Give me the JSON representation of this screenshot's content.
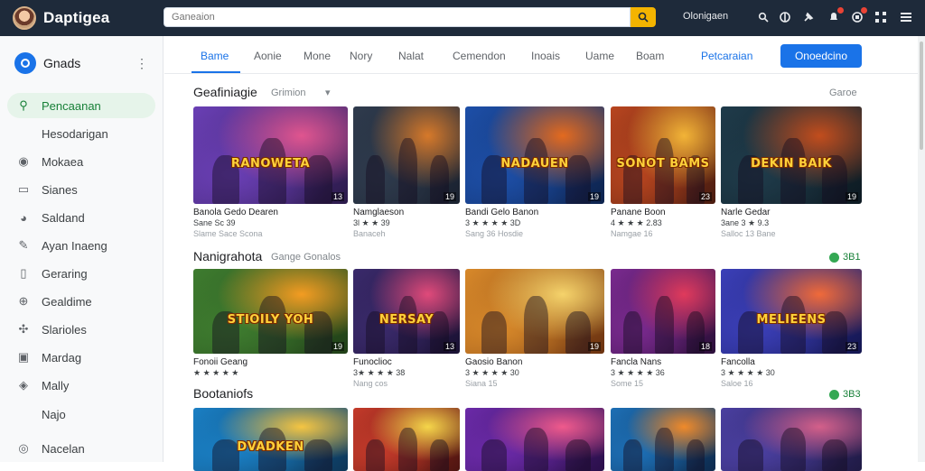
{
  "app": {
    "title": "Daptigea"
  },
  "search": {
    "placeholder": "Ganeaion"
  },
  "topbar": {
    "link": "Olonigaen"
  },
  "sidebar": {
    "header": "Gnads",
    "items": [
      {
        "label": "Pencaanan",
        "icon": "search-icon",
        "active": true
      },
      {
        "label": "Hesodarigan",
        "icon": ""
      },
      {
        "label": "Mokaea",
        "icon": "location-pin-icon"
      },
      {
        "label": "Sianes",
        "icon": "card-icon"
      },
      {
        "label": "Saldand",
        "icon": "palette-icon"
      },
      {
        "label": "Ayan Inaeng",
        "icon": "pen-icon"
      },
      {
        "label": "Geraring",
        "icon": "blank-page-icon"
      },
      {
        "label": "Gealdime",
        "icon": "gamepad-icon"
      },
      {
        "label": "Slarioles",
        "icon": "puzzle-icon"
      },
      {
        "label": "Mardag",
        "icon": "image-icon"
      },
      {
        "label": "Mally",
        "icon": "map-pin-icon"
      },
      {
        "label": "Najo",
        "icon": ""
      },
      {
        "label": "Nacelan",
        "icon": "account-circle-icon"
      }
    ]
  },
  "tabs": {
    "items": [
      "Bame",
      "Aonie",
      "Mone",
      "Nory",
      "Nalat",
      "Cemendon",
      "Inoais",
      "Uame",
      "Boam"
    ],
    "link": "Petcaraian",
    "button": "Onoedcino"
  },
  "sections": [
    {
      "title": "Geafiniagie",
      "subtitle": "Grimion",
      "right": "Garoe",
      "cards": [
        {
          "title": "Banola Gedo Dearen",
          "rating": "Sane Sc 39",
          "meta": "Slame Sace Scona",
          "age": "13",
          "word": "RANOWETA"
        },
        {
          "title": "Namglaeson",
          "rating": "3l ★ ★ 39",
          "meta": "Banaceh",
          "age": "19",
          "word": ""
        },
        {
          "title": "Bandi Gelo Banon",
          "rating": "3 ★ ★ ★ ★ 3D",
          "meta": "Sang 36 Hosdie",
          "age": "19",
          "word": "NADAUEN"
        },
        {
          "title": "Panane Boon",
          "rating": "4 ★ ★ ★ 2.83",
          "meta": "Namgae 16",
          "age": "23",
          "word": "SONOT BAMS"
        },
        {
          "title": "Narle Gedar",
          "rating": "3ane 3 ★ 9.3",
          "meta": "Salloc 13 Bane",
          "age": "19",
          "word": "DEKIN BAIK"
        }
      ]
    },
    {
      "title": "Nanigrahota",
      "subtitle": "Gange Gonalos",
      "badge": "3B1",
      "cards": [
        {
          "title": "Fonoii Geang",
          "rating": "★ ★ ★ ★ ★",
          "meta": "",
          "age": "19",
          "word": "STIOILY YOH"
        },
        {
          "title": "Funoclioc",
          "rating": "3★ ★ ★ ★ 38",
          "meta": "Nang cos",
          "age": "13",
          "word": "NERSAY"
        },
        {
          "title": "Gaosio Banon",
          "rating": "3 ★ ★ ★ ★ 30",
          "meta": "Siana 15",
          "age": "19",
          "word": ""
        },
        {
          "title": "Fancla Nans",
          "rating": "3 ★ ★ ★ ★ 36",
          "meta": "Some 15",
          "age": "18",
          "word": ""
        },
        {
          "title": "Fancolla",
          "rating": "3 ★ ★ ★ ★ 30",
          "meta": "Saloe 16",
          "age": "23",
          "word": "MELIEENS"
        }
      ]
    },
    {
      "title": "Bootaniofs",
      "badge": "3B3",
      "cards": [
        {
          "word": "DVADKEN"
        },
        {
          "word": ""
        },
        {
          "word": ""
        },
        {
          "word": ""
        },
        {
          "word": ""
        }
      ]
    }
  ],
  "colors": {
    "topbar": "#1e2a3a",
    "accent": "#1a73e8",
    "active_green": "#188038"
  }
}
